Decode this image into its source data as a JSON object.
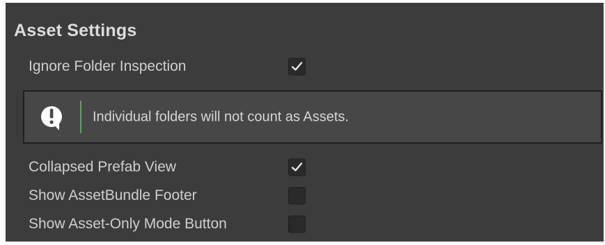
{
  "section": {
    "title": "Asset Settings"
  },
  "settings": [
    {
      "label": "Ignore Folder Inspection",
      "checked": true
    },
    {
      "label": "Collapsed Prefab View",
      "checked": true
    },
    {
      "label": "Show AssetBundle Footer",
      "checked": false
    },
    {
      "label": "Show Asset-Only Mode Button",
      "checked": false
    }
  ],
  "helpbox": {
    "icon": "info-exclamation-icon",
    "message": "Individual folders will not count as Assets.",
    "accent_color": "#5ea35e"
  },
  "colors": {
    "panel_bg": "#3c3c3c",
    "checkbox_bg": "#2a2a2a",
    "checkmark": "#e6e6e6"
  }
}
